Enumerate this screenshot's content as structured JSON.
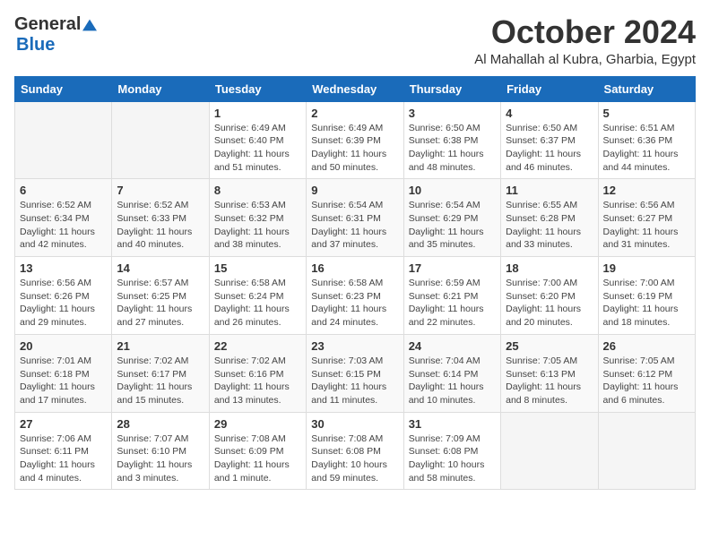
{
  "header": {
    "logo_general": "General",
    "logo_blue": "Blue",
    "month_title": "October 2024",
    "subtitle": "Al Mahallah al Kubra, Gharbia, Egypt"
  },
  "days_of_week": [
    "Sunday",
    "Monday",
    "Tuesday",
    "Wednesday",
    "Thursday",
    "Friday",
    "Saturday"
  ],
  "weeks": [
    [
      {
        "day": "",
        "info": ""
      },
      {
        "day": "",
        "info": ""
      },
      {
        "day": "1",
        "info": "Sunrise: 6:49 AM\nSunset: 6:40 PM\nDaylight: 11 hours and 51 minutes."
      },
      {
        "day": "2",
        "info": "Sunrise: 6:49 AM\nSunset: 6:39 PM\nDaylight: 11 hours and 50 minutes."
      },
      {
        "day": "3",
        "info": "Sunrise: 6:50 AM\nSunset: 6:38 PM\nDaylight: 11 hours and 48 minutes."
      },
      {
        "day": "4",
        "info": "Sunrise: 6:50 AM\nSunset: 6:37 PM\nDaylight: 11 hours and 46 minutes."
      },
      {
        "day": "5",
        "info": "Sunrise: 6:51 AM\nSunset: 6:36 PM\nDaylight: 11 hours and 44 minutes."
      }
    ],
    [
      {
        "day": "6",
        "info": "Sunrise: 6:52 AM\nSunset: 6:34 PM\nDaylight: 11 hours and 42 minutes."
      },
      {
        "day": "7",
        "info": "Sunrise: 6:52 AM\nSunset: 6:33 PM\nDaylight: 11 hours and 40 minutes."
      },
      {
        "day": "8",
        "info": "Sunrise: 6:53 AM\nSunset: 6:32 PM\nDaylight: 11 hours and 38 minutes."
      },
      {
        "day": "9",
        "info": "Sunrise: 6:54 AM\nSunset: 6:31 PM\nDaylight: 11 hours and 37 minutes."
      },
      {
        "day": "10",
        "info": "Sunrise: 6:54 AM\nSunset: 6:29 PM\nDaylight: 11 hours and 35 minutes."
      },
      {
        "day": "11",
        "info": "Sunrise: 6:55 AM\nSunset: 6:28 PM\nDaylight: 11 hours and 33 minutes."
      },
      {
        "day": "12",
        "info": "Sunrise: 6:56 AM\nSunset: 6:27 PM\nDaylight: 11 hours and 31 minutes."
      }
    ],
    [
      {
        "day": "13",
        "info": "Sunrise: 6:56 AM\nSunset: 6:26 PM\nDaylight: 11 hours and 29 minutes."
      },
      {
        "day": "14",
        "info": "Sunrise: 6:57 AM\nSunset: 6:25 PM\nDaylight: 11 hours and 27 minutes."
      },
      {
        "day": "15",
        "info": "Sunrise: 6:58 AM\nSunset: 6:24 PM\nDaylight: 11 hours and 26 minutes."
      },
      {
        "day": "16",
        "info": "Sunrise: 6:58 AM\nSunset: 6:23 PM\nDaylight: 11 hours and 24 minutes."
      },
      {
        "day": "17",
        "info": "Sunrise: 6:59 AM\nSunset: 6:21 PM\nDaylight: 11 hours and 22 minutes."
      },
      {
        "day": "18",
        "info": "Sunrise: 7:00 AM\nSunset: 6:20 PM\nDaylight: 11 hours and 20 minutes."
      },
      {
        "day": "19",
        "info": "Sunrise: 7:00 AM\nSunset: 6:19 PM\nDaylight: 11 hours and 18 minutes."
      }
    ],
    [
      {
        "day": "20",
        "info": "Sunrise: 7:01 AM\nSunset: 6:18 PM\nDaylight: 11 hours and 17 minutes."
      },
      {
        "day": "21",
        "info": "Sunrise: 7:02 AM\nSunset: 6:17 PM\nDaylight: 11 hours and 15 minutes."
      },
      {
        "day": "22",
        "info": "Sunrise: 7:02 AM\nSunset: 6:16 PM\nDaylight: 11 hours and 13 minutes."
      },
      {
        "day": "23",
        "info": "Sunrise: 7:03 AM\nSunset: 6:15 PM\nDaylight: 11 hours and 11 minutes."
      },
      {
        "day": "24",
        "info": "Sunrise: 7:04 AM\nSunset: 6:14 PM\nDaylight: 11 hours and 10 minutes."
      },
      {
        "day": "25",
        "info": "Sunrise: 7:05 AM\nSunset: 6:13 PM\nDaylight: 11 hours and 8 minutes."
      },
      {
        "day": "26",
        "info": "Sunrise: 7:05 AM\nSunset: 6:12 PM\nDaylight: 11 hours and 6 minutes."
      }
    ],
    [
      {
        "day": "27",
        "info": "Sunrise: 7:06 AM\nSunset: 6:11 PM\nDaylight: 11 hours and 4 minutes."
      },
      {
        "day": "28",
        "info": "Sunrise: 7:07 AM\nSunset: 6:10 PM\nDaylight: 11 hours and 3 minutes."
      },
      {
        "day": "29",
        "info": "Sunrise: 7:08 AM\nSunset: 6:09 PM\nDaylight: 11 hours and 1 minute."
      },
      {
        "day": "30",
        "info": "Sunrise: 7:08 AM\nSunset: 6:08 PM\nDaylight: 10 hours and 59 minutes."
      },
      {
        "day": "31",
        "info": "Sunrise: 7:09 AM\nSunset: 6:08 PM\nDaylight: 10 hours and 58 minutes."
      },
      {
        "day": "",
        "info": ""
      },
      {
        "day": "",
        "info": ""
      }
    ]
  ]
}
